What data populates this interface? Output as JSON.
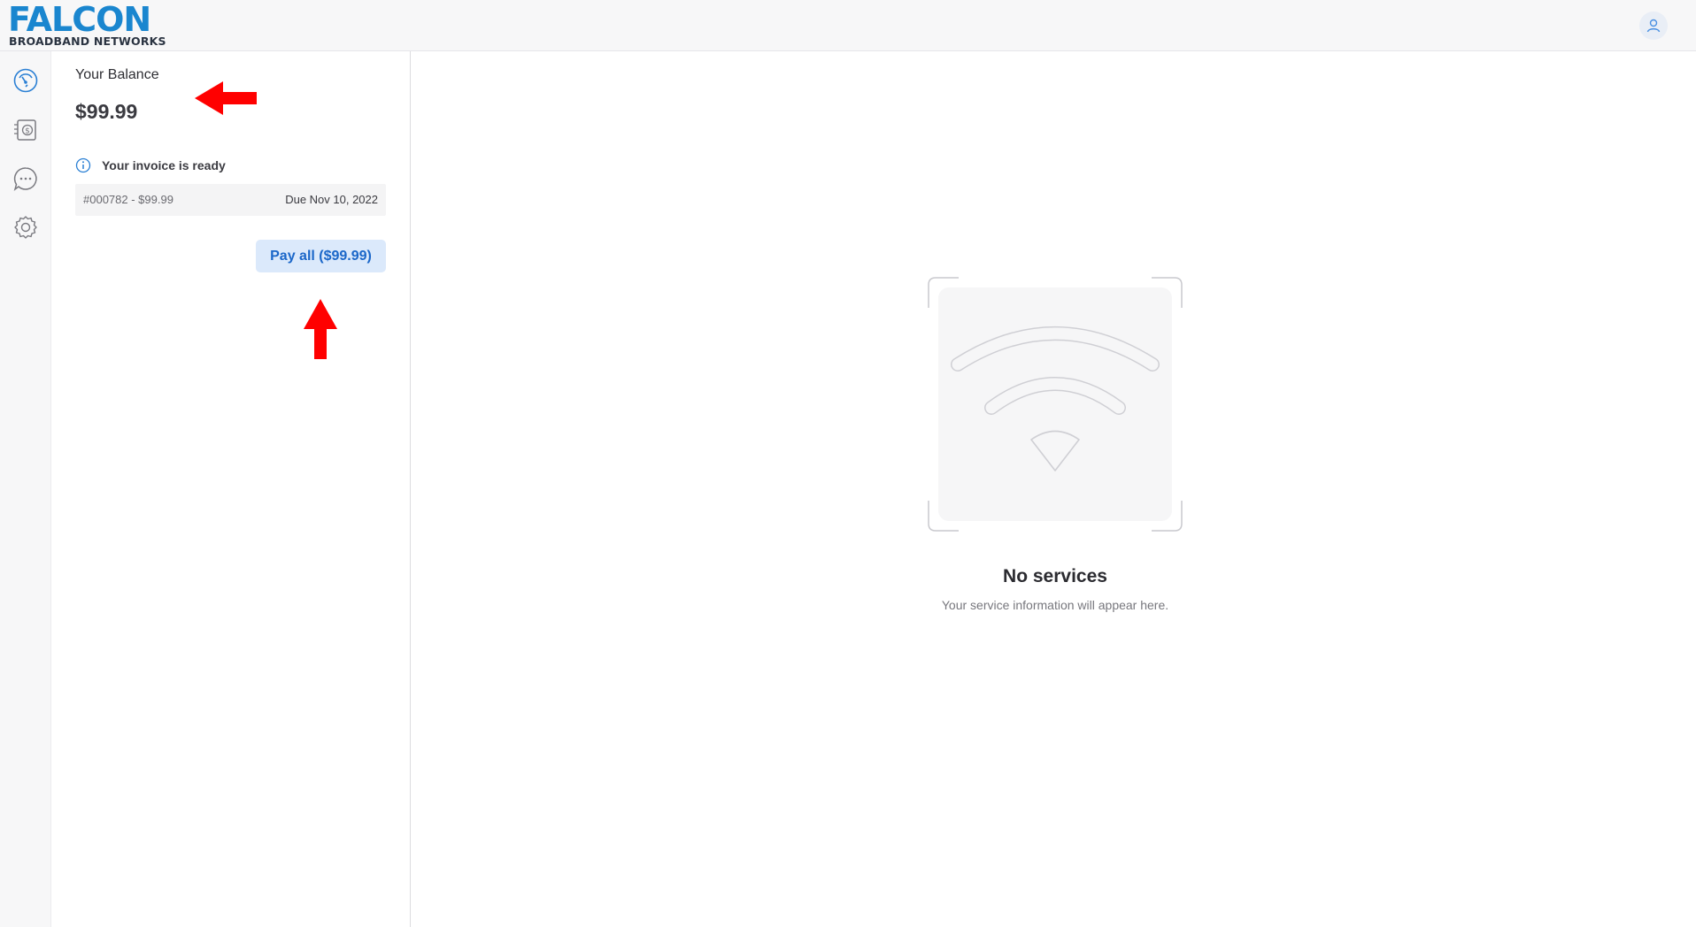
{
  "header": {
    "brand_name": "FALCON",
    "brand_tagline": "BROADBAND NETWORKS"
  },
  "nav": {
    "items": [
      {
        "icon": "speedometer-icon",
        "active": true
      },
      {
        "icon": "billing-icon",
        "active": false
      },
      {
        "icon": "chat-icon",
        "active": false
      },
      {
        "icon": "gear-icon",
        "active": false
      }
    ]
  },
  "balance": {
    "label": "Your Balance",
    "amount": "$99.99",
    "invoice_notice": "Your invoice is ready",
    "invoice_ref": "#000782 - $99.99",
    "invoice_due": "Due Nov 10, 2022",
    "pay_label": "Pay all ($99.99)"
  },
  "main": {
    "empty_title": "No services",
    "empty_subtitle": "Your service information will appear here."
  },
  "colors": {
    "brand": "#1a86cf",
    "accent": "#1b67c9",
    "annotation": "#ff0000"
  }
}
